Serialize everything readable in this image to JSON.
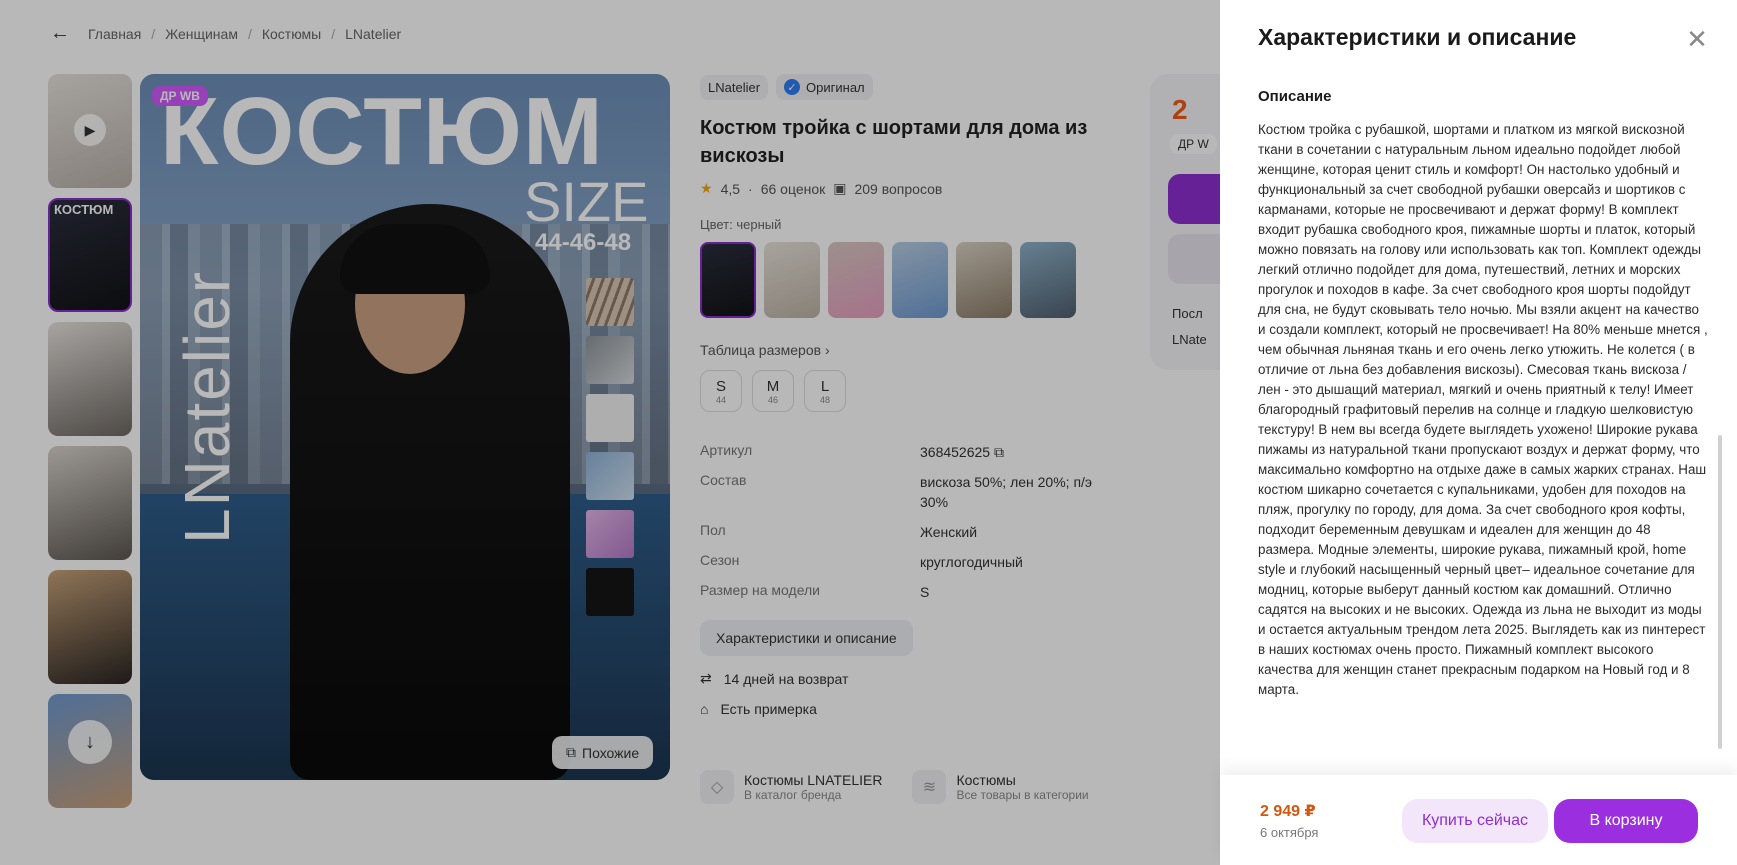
{
  "breadcrumbs": [
    "Главная",
    "Женщинам",
    "Костюмы",
    "LNatelier"
  ],
  "gallery": {
    "badge": "ДР WB",
    "hero_title": "КОСТЮМ",
    "hero_size": "SIZE",
    "hero_sizes": "44-46-48",
    "hero_brand": "LNatelier",
    "similar_label": "Похожие",
    "thumb_mini": "КОСТЮМ"
  },
  "product": {
    "brand": "LNatelier",
    "original_label": "Оригинал",
    "title": "Костюм тройка с шортами для дома из вискозы",
    "rating": "4,5",
    "reviews": "66 оценок",
    "questions": "209 вопросов",
    "color_label": "Цвет: черный",
    "size_table_label": "Таблица размеров",
    "sizes": [
      {
        "label": "S",
        "ru": "44"
      },
      {
        "label": "M",
        "ru": "46"
      },
      {
        "label": "L",
        "ru": "48"
      }
    ],
    "specs": [
      {
        "k": "Артикул",
        "v": "368452625"
      },
      {
        "k": "Состав",
        "v": "вискоза 50%; лен 20%; п/э 30%"
      },
      {
        "k": "Пол",
        "v": "Женский"
      },
      {
        "k": "Сезон",
        "v": "круглогодичный"
      },
      {
        "k": "Размер на модели",
        "v": "S"
      }
    ],
    "char_button": "Характеристики и описание",
    "perks": [
      "14 дней на возврат",
      "Есть примерка"
    ],
    "catalog": [
      {
        "t1": "Костюмы LNATELIER",
        "t2": "В каталог бренда"
      },
      {
        "t1": "Костюмы",
        "t2": "Все товары в категории"
      }
    ]
  },
  "buybox": {
    "price_partial": "2",
    "wb_partial": "ДР W",
    "line1": "Посл",
    "line2": "LNate"
  },
  "panel": {
    "title": "Характеристики и описание",
    "section": "Описание",
    "description": "Костюм тройка с рубашкой, шортами и платком из мягкой вискозной ткани в сочетании с натуральным льном идеально подойдет любой женщине, которая ценит стиль и комфорт! Он настолько удобный и функциональный за счет свободной рубашки оверсайз и шортиков с карманами, которые не просвечивают и держат форму! В комплект входит рубашка свободного кроя, пижамные шорты и платок, который можно повязать на голову или использовать как топ. Комплект одежды легкий отлично подойдет для дома, путешествий, летних и морских прогулок и походов в кафе. За счет свободного кроя шорты подойдут для сна, не будут сковывать тело ночью. Мы взяли акцент на качество и создали комплект, который не просвечивает! На 80% меньше мнется , чем обычная льняная ткань и его очень легко утюжить. Не колется ( в отличие от льна без добавления вискозы). Смесовая ткань вискоза / лен - это дышащий материал, мягкий и очень приятный к телу! Имеет благородный графитовый перелив на солнце и гладкую шелковистую текстуру! В нем вы всегда будете выглядеть ухожено! Широкие рукава пижамы из натуральной ткани пропускают воздух и держат форму, что максимально комфортно на отдыхе даже в самых жарких странах. Наш костюм шикарно сочетается с купальниками, удобен для походов на пляж, прогулку по городу, для дома. За счет свободного кроя кофты, подходит беременным девушкам и идеален для женщин до 48 размера. Модные элементы, широкие рукава, пижамный крой, home style и глубокий насыщенный черный цвет– идеальное сочетание для модниц, которые выберут данный костюм как домашний. Отлично садятся на высоких и не высоких. Одежда из льна не выходит из моды и остается актуальным трендом лета 2025. Выглядеть как из пинтерест в наших костюмах очень просто. Пижамный комплект высокого качества для женщин станет прекрасным подарком на Новый год и 8 марта.",
    "price": "2 949 ₽",
    "delivery": "6 октября",
    "buy_now": "Купить сейчас",
    "to_cart": "В корзину"
  },
  "colors": {
    "accent": "#9b2fe0",
    "price": "#d5570e"
  }
}
